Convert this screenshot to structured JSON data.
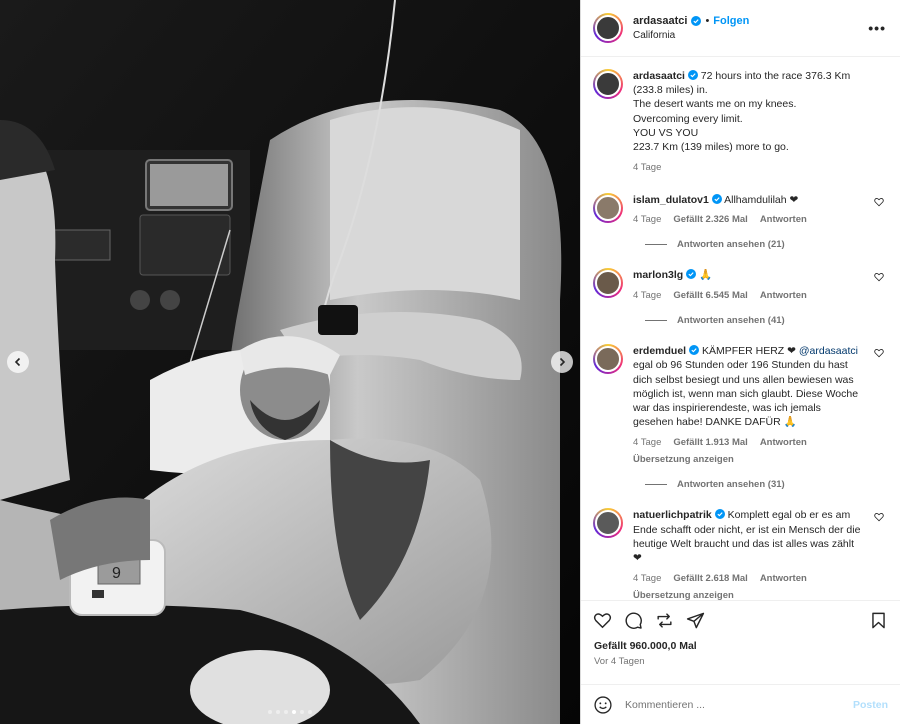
{
  "post": {
    "username": "ardasaatci",
    "follow_label": "Folgen",
    "separator": "•",
    "location": "California",
    "more_label": "•••",
    "caption_lines": [
      "72 hours into the race 376.3 Km",
      "(233.8 miles) in.",
      "The desert wants me on my knees.",
      "Overcoming every limit.",
      "YOU VS YOU",
      "223.7 Km (139 miles) more to go."
    ],
    "caption_age": "4 Tage",
    "likes": "Gefällt 960.000,0 Mal",
    "date": "Vor 4 Tagen"
  },
  "comments": [
    {
      "username": "islam_dulatov1",
      "text": "Allhamdulilah ❤",
      "age": "4 Tage",
      "likes": "Gefällt 2.326 Mal",
      "reply": "Antworten",
      "replies": "Antworten ansehen (21)"
    },
    {
      "username": "marlon3lg",
      "text": "🙏",
      "age": "4 Tage",
      "likes": "Gefällt 6.545 Mal",
      "reply": "Antworten",
      "replies": "Antworten ansehen (41)"
    },
    {
      "username": "erdemduel",
      "text_prefix": "KÄMPFER HERZ ❤",
      "mention": "@ardasaatci",
      "text": "egal ob 96 Stunden oder 196 Stunden du hast dich selbst besiegt und uns allen bewiesen was möglich ist, wenn man sich glaubt. Diese Woche war das inspirierendeste, was ich jemals gesehen habe! DANKE DAFÜR 🙏",
      "age": "4 Tage",
      "likes": "Gefällt 1.913 Mal",
      "reply": "Antworten",
      "translate": "Übersetzung anzeigen",
      "replies": "Antworten ansehen (31)"
    },
    {
      "username": "natuerlichpatrik",
      "text": "Komplett egal ob er es am Ende schafft oder nicht, er ist ein Mensch der die heutige Welt braucht und das ist alles was zählt ❤",
      "age": "4 Tage",
      "likes": "Gefällt 2.618 Mal",
      "reply": "Antworten",
      "translate": "Übersetzung anzeigen"
    }
  ],
  "composer": {
    "placeholder": "Kommentieren ...",
    "post_label": "Posten"
  },
  "media": {
    "slide_count": 6,
    "active_slide": 4,
    "bp_display": "9"
  },
  "colors": {
    "accent": "#0095f6",
    "verified": "#0095f6",
    "heart": "#ff3040"
  }
}
